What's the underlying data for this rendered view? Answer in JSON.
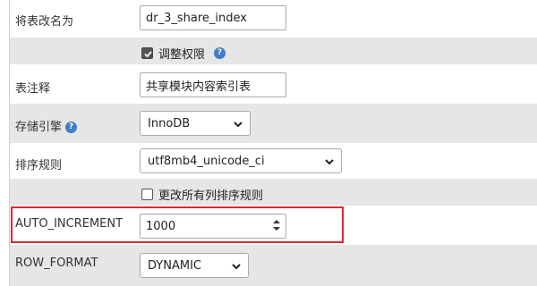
{
  "rows": {
    "rename": {
      "label": "将表改名为",
      "value": "dr_3_share_index"
    },
    "adjust_perms": {
      "label": "调整权限",
      "checked": true
    },
    "comment": {
      "label": "表注释",
      "value": "共享模块内容索引表"
    },
    "engine": {
      "label": "存储引擎",
      "value": "InnoDB"
    },
    "collation": {
      "label": "排序规则",
      "value": "utf8mb4_unicode_ci"
    },
    "change_all_collation": {
      "label": "更改所有列排序规则",
      "checked": false
    },
    "auto_increment": {
      "label": "AUTO_INCREMENT",
      "value": "1000"
    },
    "row_format": {
      "label": "ROW_FORMAT",
      "value": "DYNAMIC"
    }
  },
  "icons": {
    "help": "help-icon",
    "chevron": "chevron-down-icon",
    "spinner": "spinner-arrows-icon",
    "check": "check-icon"
  },
  "colors": {
    "highlight": "#e2272e",
    "help": "#3f7ec6",
    "row_alt": "#e6e6e6"
  }
}
